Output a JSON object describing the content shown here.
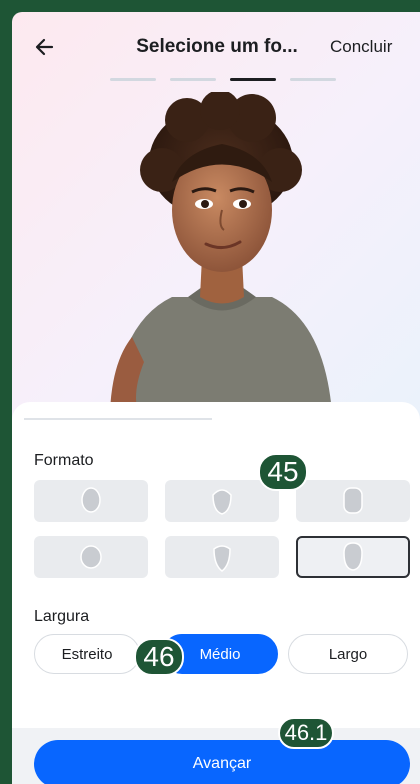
{
  "header": {
    "title": "Selecione um fo...",
    "done_label": "Concluir",
    "back_icon": "arrow-left-icon",
    "progress_steps": 4,
    "active_step": 3
  },
  "format": {
    "label": "Formato",
    "options_count": 6,
    "selected_index": 5
  },
  "width": {
    "label": "Largura",
    "options": [
      "Estreito",
      "Médio",
      "Largo"
    ],
    "selected": "Médio"
  },
  "cta": {
    "label": "Avançar"
  },
  "annotations": [
    "45",
    "46",
    "46.1"
  ],
  "colors": {
    "accent": "#0866ff",
    "badge": "#1e5535"
  }
}
